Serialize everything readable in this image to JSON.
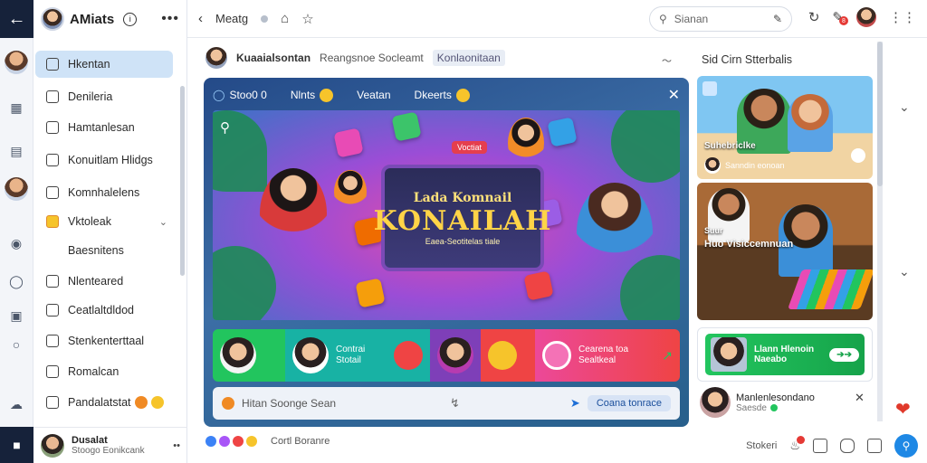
{
  "app": {
    "title": "AMiats",
    "footer_user": {
      "name": "Dusalat",
      "status": "Stoogo Eonikcank"
    }
  },
  "sidebar": {
    "items": [
      {
        "label": "Hkentan"
      },
      {
        "label": "Denileria"
      },
      {
        "label": "Hamtanlesan"
      },
      {
        "label": "Konuitlam Hlidgs"
      },
      {
        "label": "Komnhalelens"
      },
      {
        "label": "Vktoleak"
      },
      {
        "label": "Baesnitens"
      },
      {
        "label": "Nlenteared"
      },
      {
        "label": "Ceatlaltdldod"
      },
      {
        "label": "Stenkenterttaal"
      },
      {
        "label": "Romalcan"
      },
      {
        "label": "Pandalatstat"
      }
    ]
  },
  "topbar": {
    "title": "Meatg",
    "search_placeholder": "Sianan"
  },
  "header": {
    "name": "Kuaaialsontan",
    "sub": "Reangsnoe Socleamt",
    "tag": "Konlaonitaan",
    "side_title": "Sid Cirn Stterbalis",
    "arrows": "〜"
  },
  "game": {
    "tabs": [
      {
        "label": "Stoo0 0"
      },
      {
        "label": "Nlnts"
      },
      {
        "label": "Veatan"
      },
      {
        "label": "Dkeerts"
      }
    ],
    "screen_line1": "Lada Komnail",
    "screen_line2": "KONAILAH",
    "screen_line3": "Eaea-Seotitelas tiale",
    "vocab_label": "Voctiat",
    "card1_text": "Contrai\nStotail",
    "card2_text": "Cearena toa\nSealtkeal",
    "composer_placeholder": "Hitan Soonge Sean",
    "composer_button": "Coana tonrace"
  },
  "side": {
    "media1_caption": "Suhebriclke",
    "media1_sub": "Sanndin eonoan",
    "media2_caption1": "Suur",
    "media2_caption2": "Huo Visiccemnuan",
    "cta_line1": "Llann Hlenoin",
    "cta_line2": "Naeabo",
    "friend_name": "Manlenlesondano",
    "friend_status": "Saesde"
  },
  "footer": {
    "status_text": "Cortl Boranre",
    "right_label": "Stokeri"
  },
  "colors": {
    "accent": "#1e88e5",
    "active_bg": "#cfe3f7",
    "panel": "#2e5b95",
    "cta": "#22c55e"
  }
}
